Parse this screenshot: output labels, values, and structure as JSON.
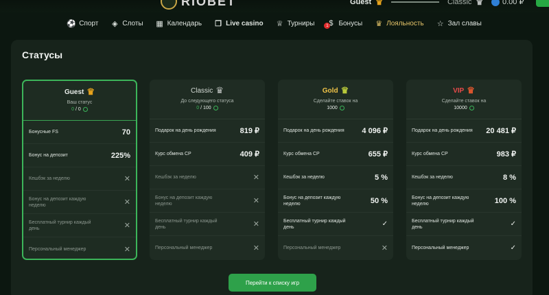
{
  "header": {
    "logo_text": "RIOBET",
    "current_status": "Guest",
    "next_status": "Classic",
    "balance": "0.00 ₽"
  },
  "nav": [
    {
      "label": "Спорт",
      "icon": "ball-icon"
    },
    {
      "label": "Слоты",
      "icon": "slots-icon"
    },
    {
      "label": "Календарь",
      "icon": "calendar-icon"
    },
    {
      "label": "Live casino",
      "icon": "cards-icon"
    },
    {
      "label": "Турниры",
      "icon": "trophy-icon"
    },
    {
      "label": "Бонусы",
      "icon": "bonus-icon",
      "badge": "1"
    },
    {
      "label": "Лояльность",
      "icon": "crown-icon"
    },
    {
      "label": "Зал славы",
      "icon": "star-icon"
    }
  ],
  "page_title": "Статусы",
  "cards": [
    {
      "name": "Guest",
      "subtitle": "Ваш статус",
      "progress_current": "0",
      "progress_total": " / 0",
      "rows": [
        {
          "label": "Бонусные FS",
          "value": "70"
        },
        {
          "label": "Бонус на депозит",
          "value": "225%"
        },
        {
          "label": "Кешбэк за неделю",
          "value": "✕"
        },
        {
          "label": "Бонус на депозит каждую неделю",
          "value": "✕"
        },
        {
          "label": "Бесплатный турнир каждый день",
          "value": "✕"
        },
        {
          "label": "Персональный менеджер",
          "value": "✕"
        }
      ]
    },
    {
      "name": "Classic",
      "subtitle": "До следующего статуса",
      "progress_current": "0",
      "progress_total": " / 100",
      "rows": [
        {
          "label": "Подарок на день рождения",
          "value": "819 ₽"
        },
        {
          "label": "Курс обмена СР",
          "value": "409 ₽"
        },
        {
          "label": "Кешбэк за неделю",
          "value": "✕"
        },
        {
          "label": "Бонус на депозит каждую неделю",
          "value": "✕"
        },
        {
          "label": "Бесплатный турнир каждый день",
          "value": "✕"
        },
        {
          "label": "Персональный менеджер",
          "value": "✕"
        }
      ]
    },
    {
      "name": "Gold",
      "subtitle": "Сделайте ставок на",
      "amount": "1000",
      "rows": [
        {
          "label": "Подарок на день рождения",
          "value": "4 096 ₽"
        },
        {
          "label": "Курс обмена СР",
          "value": "655 ₽"
        },
        {
          "label": "Кешбэк за неделю",
          "value": "5 %"
        },
        {
          "label": "Бонус на депозит каждую неделю",
          "value": "50 %"
        },
        {
          "label": "Бесплатный турнир каждый день",
          "value": "✓"
        },
        {
          "label": "Персональный менеджер",
          "value": "✕"
        }
      ]
    },
    {
      "name": "VIP",
      "subtitle": "Сделайте ставок на",
      "amount": "10000",
      "rows": [
        {
          "label": "Подарок на день рождения",
          "value": "20 481 ₽"
        },
        {
          "label": "Курс обмена СР",
          "value": "983 ₽"
        },
        {
          "label": "Кешбэк за неделю",
          "value": "8 %"
        },
        {
          "label": "Бонус на депозит каждую неделю",
          "value": "100 %"
        },
        {
          "label": "Бесплатный турнир каждый день",
          "value": "✓"
        },
        {
          "label": "Персональный менеджер",
          "value": "✓"
        }
      ]
    }
  ],
  "cta_label": "Перейти к списку игр",
  "colors": {
    "accent": "#2ea14a",
    "gold": "#f0c348",
    "vip": "#e94a4a",
    "background": "#0c1710"
  }
}
